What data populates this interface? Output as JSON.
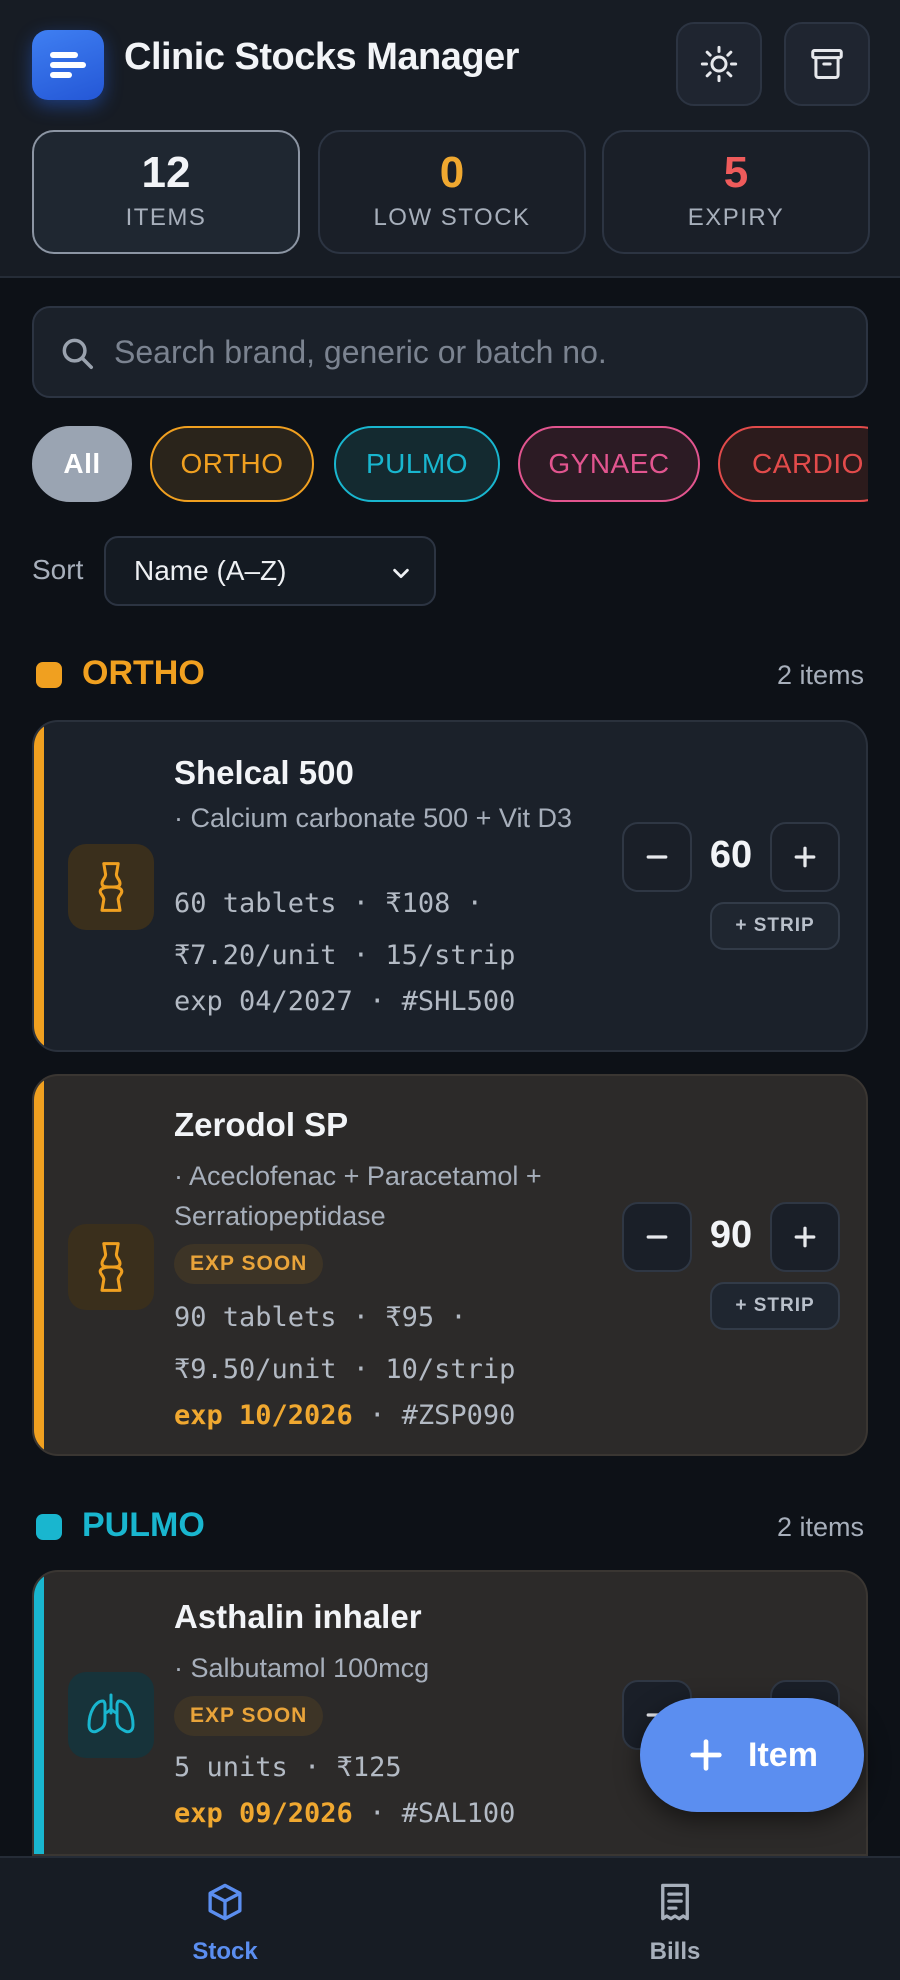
{
  "header": {
    "title": "Clinic Stocks Manager",
    "icons": [
      "sun-icon",
      "archive-icon"
    ]
  },
  "stats": [
    {
      "value": "12",
      "label": "ITEMS",
      "color": "#f2f4f7"
    },
    {
      "value": "0",
      "label": "LOW STOCK",
      "color": "#f0a830"
    },
    {
      "value": "5",
      "label": "EXPIRY",
      "color": "#ef5b5b"
    }
  ],
  "search": {
    "placeholder": "Search brand, generic or batch no.",
    "value": ""
  },
  "filters": [
    {
      "label": "All",
      "color": "#9aa4b2"
    },
    {
      "label": "ORTHO",
      "color": "#f0a020"
    },
    {
      "label": "PULMO",
      "color": "#19b6cf"
    },
    {
      "label": "GYNAEC",
      "color": "#e2558f"
    },
    {
      "label": "CARDIO",
      "color": "#e24b4b"
    }
  ],
  "sort": {
    "label": "Sort",
    "selected": "Name (A–Z)"
  },
  "sections": [
    {
      "name": "ORTHO",
      "count": "2 items",
      "color": "#f0a020",
      "items": [
        {
          "name": "Shelcal 500",
          "generic": "· Calcium carbonate 500 + Vit D3",
          "line1": "60 tablets · ₹108 ·",
          "line2": "₹7.20/unit · 15/strip",
          "exp": "exp 04/2027",
          "batch": " · #SHL500",
          "qty": "60",
          "strip_label": "+ STRIP",
          "icon": "bone-icon"
        },
        {
          "name": "Zerodol SP",
          "generic": "· Aceclofenac + Paracetamol + Serratiopeptidase",
          "badge": "EXP SOON",
          "line1": "90 tablets · ₹95 ·",
          "line2": "₹9.50/unit · 10/strip",
          "exp": "exp 10/2026",
          "batch": " · #ZSP090",
          "qty": "90",
          "strip_label": "+ STRIP",
          "icon": "bone-icon"
        }
      ]
    },
    {
      "name": "PULMO",
      "count": "2 items",
      "color": "#19b6cf",
      "items": [
        {
          "name": "Asthalin inhaler",
          "generic": "· Salbutamol 100mcg",
          "badge": "EXP SOON",
          "line1": "5 units · ₹125",
          "exp": "exp 09/2026",
          "batch": " · #SAL100",
          "icon": "lungs-icon"
        }
      ]
    }
  ],
  "fab": {
    "label": "Item"
  },
  "nav": [
    {
      "label": "Stock",
      "icon": "box-icon",
      "active": true
    },
    {
      "label": "Bills",
      "icon": "receipt-icon",
      "active": false
    }
  ]
}
